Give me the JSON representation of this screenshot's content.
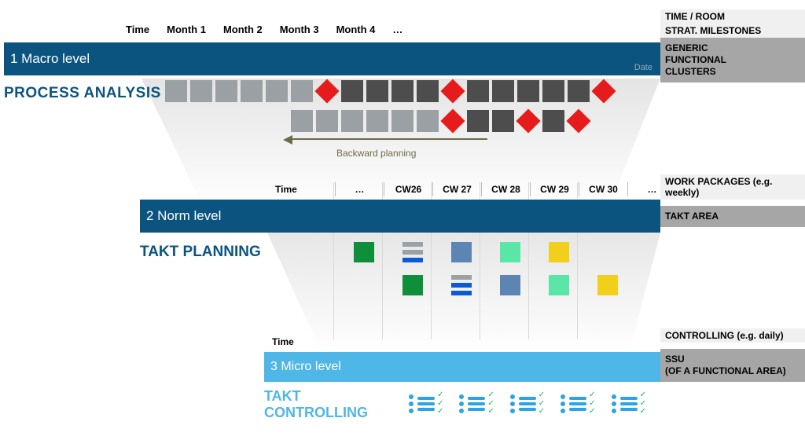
{
  "level1": {
    "title": "1 Macro level",
    "date_label": "Date",
    "process_label": "PROCESS ANALYSIS",
    "time_header": [
      "Time",
      "Month 1",
      "Month 2",
      "Month 3",
      "Month 4",
      "…"
    ],
    "row_a": [
      "sq",
      "sq",
      "sq",
      "sq",
      "sq",
      "sq",
      "dia",
      "dk",
      "dk",
      "dk",
      "dk",
      "dia",
      "dk",
      "dk",
      "dk",
      "dk",
      "dk",
      "dia"
    ],
    "row_b": [
      "sq",
      "sq",
      "sq",
      "sq",
      "sq",
      "sq",
      "dia",
      "dk",
      "dk",
      "dia",
      "dk",
      "dia"
    ],
    "backward_label": "Backward planning"
  },
  "level2": {
    "title": "2 Norm level",
    "takt_label": "TAKT PLANNING",
    "time_header": [
      "Time",
      "…",
      "CW26",
      "CW 27",
      "CW 28",
      "CW 29",
      "CW 30",
      "…"
    ],
    "row1": [
      {
        "kind": "solid",
        "color": "#0f8f3a"
      },
      {
        "kind": "bars",
        "colors": [
          "#9aa0a4",
          "#9aa0a4",
          "#0b5bd6"
        ]
      },
      {
        "kind": "solid",
        "color": "#5d85b3"
      },
      {
        "kind": "solid",
        "color": "#5ae6a7"
      },
      {
        "kind": "solid",
        "color": "#f2cf1b"
      }
    ],
    "row2": [
      {
        "kind": "blank"
      },
      {
        "kind": "solid",
        "color": "#0f8f3a"
      },
      {
        "kind": "bars",
        "colors": [
          "#9aa0a4",
          "#0b5bd6",
          "#0b5bd6"
        ]
      },
      {
        "kind": "solid",
        "color": "#5d85b3"
      },
      {
        "kind": "solid",
        "color": "#5ae6a7"
      },
      {
        "kind": "solid",
        "color": "#f2cf1b"
      }
    ]
  },
  "level3": {
    "title": "3 Micro level",
    "time_label": "Time",
    "takt_label": "TAKT\nCONTROLLING",
    "cell_count": 5
  },
  "sidebar": {
    "s1": {
      "head1": "TIME / ROOM",
      "head2": "STRAT.  MILESTONES",
      "block": "GENERIC FUNCTIONAL CLUSTERS"
    },
    "s2": {
      "head": "WORK PACKAGES (e.g. weekly)",
      "block": "TAKT AREA"
    },
    "s3": {
      "head": "CONTROLLING (e.g. daily)",
      "block": "SSU\n(OF A FUNCTIONAL AREA)"
    }
  }
}
